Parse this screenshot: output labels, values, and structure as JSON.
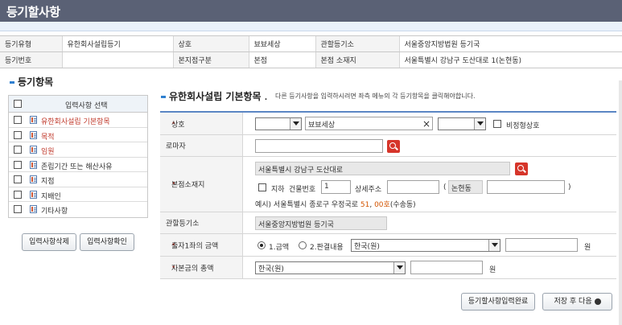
{
  "page_title": "등기할사항",
  "info_table": {
    "row1": [
      "등기유형",
      "유한회사설립등기",
      "상호",
      "뵤뵤세상",
      "관할등기소",
      "서울중앙지방법원 등기국"
    ],
    "row2": [
      "등기번호",
      "",
      "본지점구분",
      "본점",
      "본점 소재지",
      "서울특별시 강남구 도산대로 1(논현동)"
    ]
  },
  "left_panel": {
    "title": "등기항목",
    "header": "입력사항 선택",
    "items": [
      {
        "label": "유한회사설립 기본항목",
        "red": true
      },
      {
        "label": "목적",
        "red": true
      },
      {
        "label": "임원",
        "red": true
      },
      {
        "label": "존립기간 또는 해산사유",
        "red": false
      },
      {
        "label": "지점",
        "red": false
      },
      {
        "label": "지배인",
        "red": false
      },
      {
        "label": "기타사항",
        "red": false
      }
    ],
    "delete_button": "입력사항삭제",
    "check_button": "입력사항확인"
  },
  "form": {
    "title": "유한회사설립 기본항목",
    "note": "다른 등기사항을 입력하시려면 좌측 메뉴의 각 등기항목을 클릭해야합니다.",
    "name_label": "상호",
    "name_value": "뵤뵤세상",
    "name_clear": "×",
    "virtual_name_label": "비정형상호",
    "roman_label": "로마자",
    "roman_value": "",
    "address_label": "본점소재지",
    "address_value": "서울특별시 강남구 도산대로",
    "basement_label": "지하",
    "building_no_label": "건물번호",
    "building_no_value": "1",
    "detail_addr_label": "상세주소",
    "dong_open": "(",
    "dong_value": "논현동",
    "dong_close": ")",
    "example_prefix": "예시) 서울특별시 종로구 우정국로 ",
    "example_num": "51",
    "example_comma": ", ",
    "example_ho": "00호",
    "example_suffix": "(수송동)",
    "registry_label": "관할등기소",
    "registry_value": "서울중앙지방법원 등기국",
    "contribution_label": "출자1좌의 금액",
    "radio1_label": "1.금액",
    "radio2_label": "2.판결내용",
    "currency_value": "한국(원)",
    "won_unit": "원",
    "capital_label": "자본금의 총액",
    "capital_currency": "한국(원)",
    "capital_unit": "원",
    "complete_button": "등기할사항입력완료",
    "save_next_button": "저장 후 다음"
  }
}
